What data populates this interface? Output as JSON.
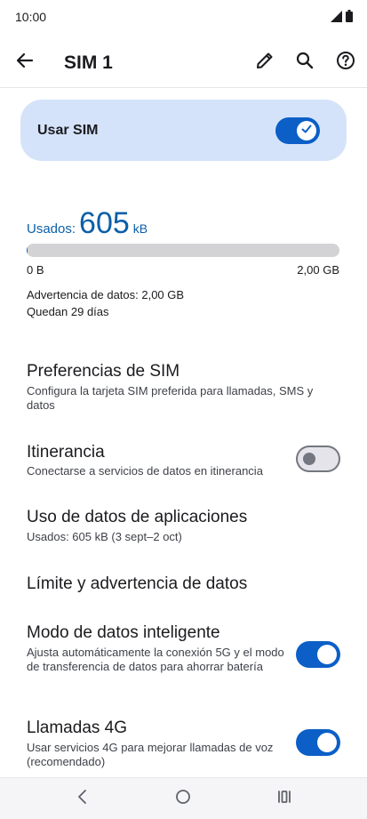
{
  "status_bar": {
    "time": "10:00"
  },
  "app_bar": {
    "title": "SIM 1"
  },
  "use_sim": {
    "label": "Usar SIM",
    "enabled": true
  },
  "usage": {
    "prefix": "Usados:",
    "value": "605",
    "unit": "kB",
    "fraction": 0.0003,
    "min_label": "0 B",
    "max_label": "2,00 GB",
    "warning": "Advertencia de datos: 2,00 GB",
    "days_left": "Quedan 29 días"
  },
  "preferences": [
    {
      "title": "Preferencias de SIM",
      "subtitle": "Configura la tarjeta SIM preferida para llamadas, SMS y datos"
    },
    {
      "title": "Itinerancia",
      "subtitle": "Conectarse a servicios de datos en itinerancia",
      "toggle": false
    },
    {
      "title": "Uso de datos de aplicaciones",
      "subtitle": "Usados: 605 kB (3 sept–2 oct)"
    },
    {
      "title": "Límite y advertencia de datos",
      "subtitle": ""
    },
    {
      "title": "Modo de datos inteligente",
      "subtitle": "Ajusta automáticamente la conexión 5G y el modo de transferencia de datos para ahorrar batería",
      "toggle": true
    },
    {
      "title": "Llamadas 4G",
      "subtitle": "Usar servicios 4G para mejorar llamadas de voz (recomendado)",
      "toggle": true
    }
  ],
  "icons": {
    "back": "arrow-left-icon",
    "edit": "pencil-icon",
    "search": "search-icon",
    "help": "help-circle-icon",
    "nav_back": "chevron-left-icon",
    "nav_home": "circle-icon",
    "nav_recents": "recents-icon"
  },
  "colors": {
    "accent": "#0b5fc7",
    "card_bg": "#d5e3fa",
    "usage_text": "#0b5fa8"
  }
}
